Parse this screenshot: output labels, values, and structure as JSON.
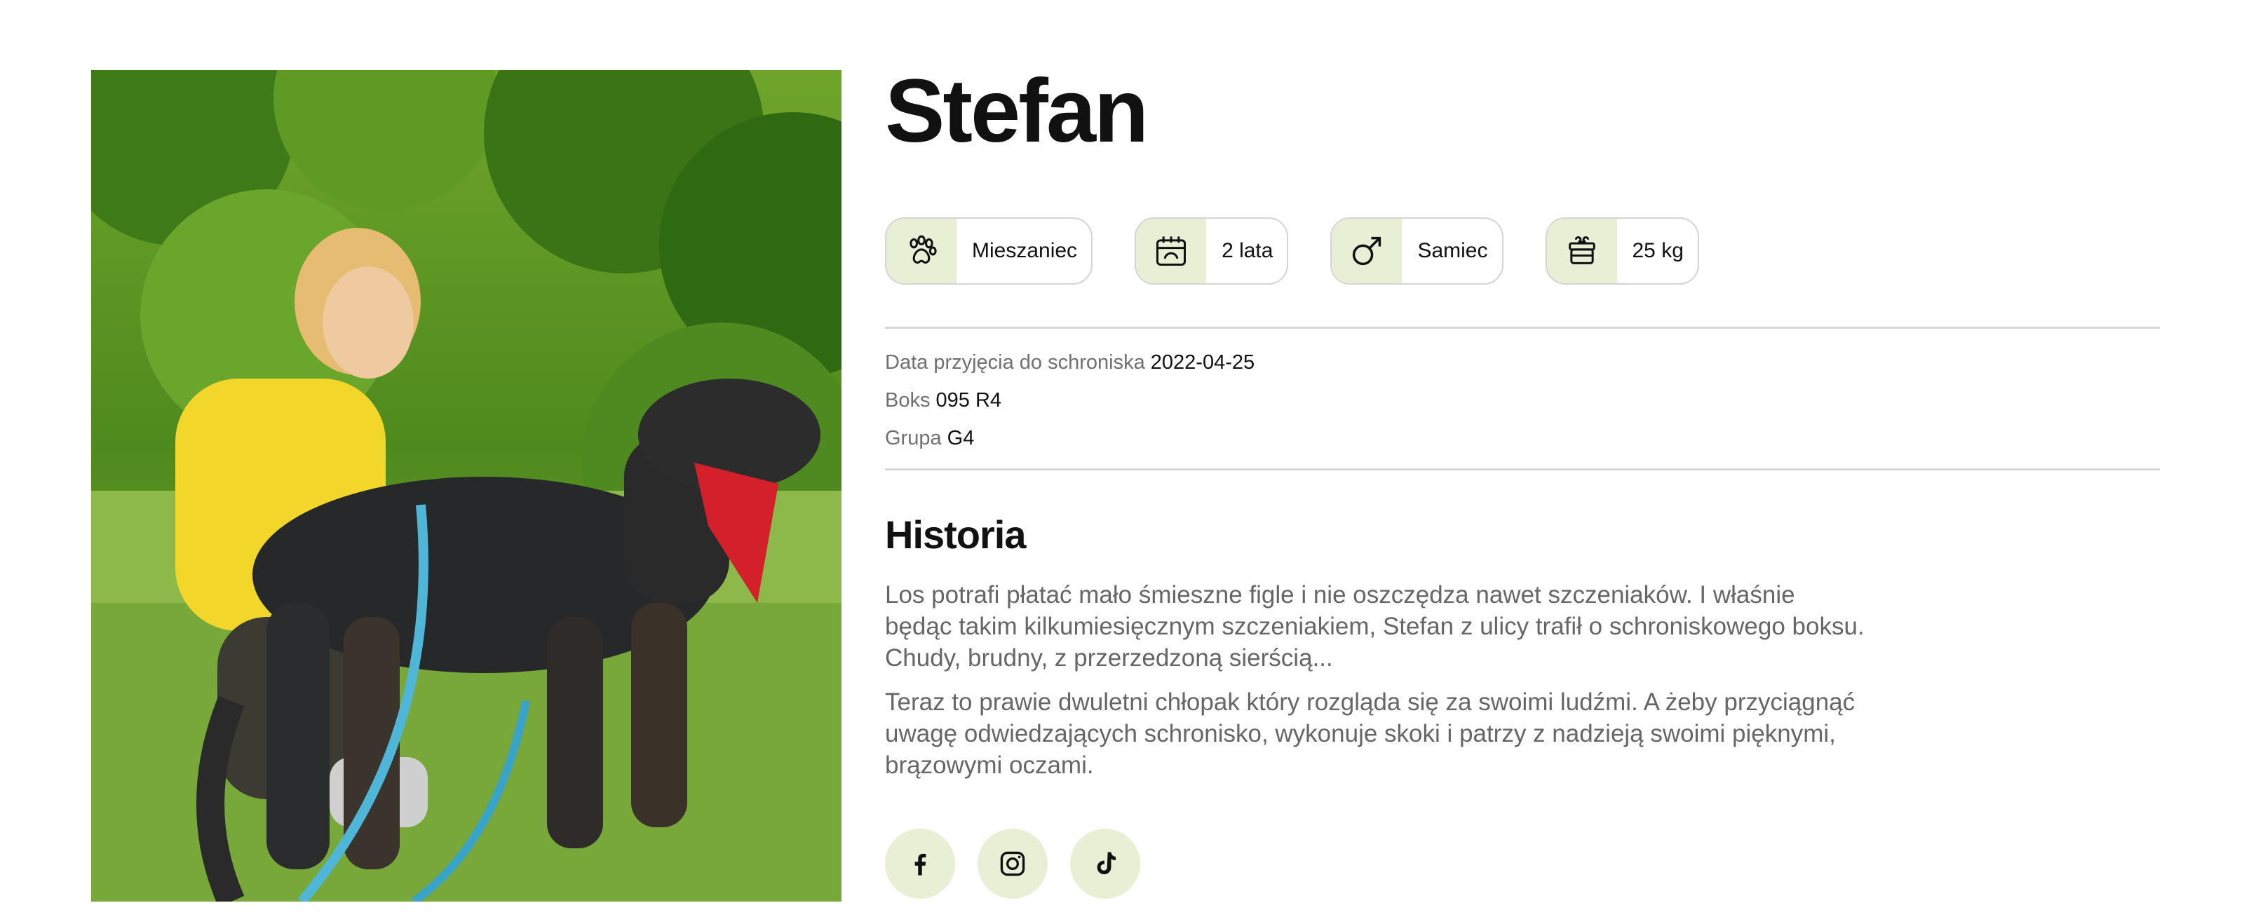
{
  "pet": {
    "name": "Stefan",
    "photo_alt": "Stefan with volunteer"
  },
  "chips": [
    {
      "icon": "paw-icon",
      "label": "Mieszaniec"
    },
    {
      "icon": "calendar-icon",
      "label": "2 lata"
    },
    {
      "icon": "male-icon",
      "label": "Samiec"
    },
    {
      "icon": "weight-icon",
      "label": "25 kg"
    }
  ],
  "details": {
    "admission_label": "Data przyjęcia do schroniska",
    "admission_value": "2022-04-25",
    "box_label": "Boks",
    "box_value": "095 R4",
    "group_label": "Grupa",
    "group_value": "G4"
  },
  "history": {
    "title": "Historia",
    "paragraphs": [
      "Los potrafi płatać mało śmieszne figle i nie oszczędza nawet szczeniaków. I właśnie będąc takim kilkumiesięcznym szczeniakiem, Stefan z ulicy trafił o schroniskowego boksu. Chudy, brudny, z przerzedzoną sierścią...",
      "Teraz to prawie dwuletni chłopak który rozgląda się za swoimi ludźmi. A żeby przyciągnąć uwagę odwiedzających schronisko, wykonuje skoki i patrzy z nadzieją swoimi pięknymi, brązowymi oczami."
    ]
  },
  "socials": [
    {
      "icon": "facebook-icon"
    },
    {
      "icon": "instagram-icon"
    },
    {
      "icon": "tiktok-icon"
    }
  ],
  "colors": {
    "chip_bg": "#e9efd5",
    "border": "#d4d4d4",
    "muted_text": "#707070"
  }
}
